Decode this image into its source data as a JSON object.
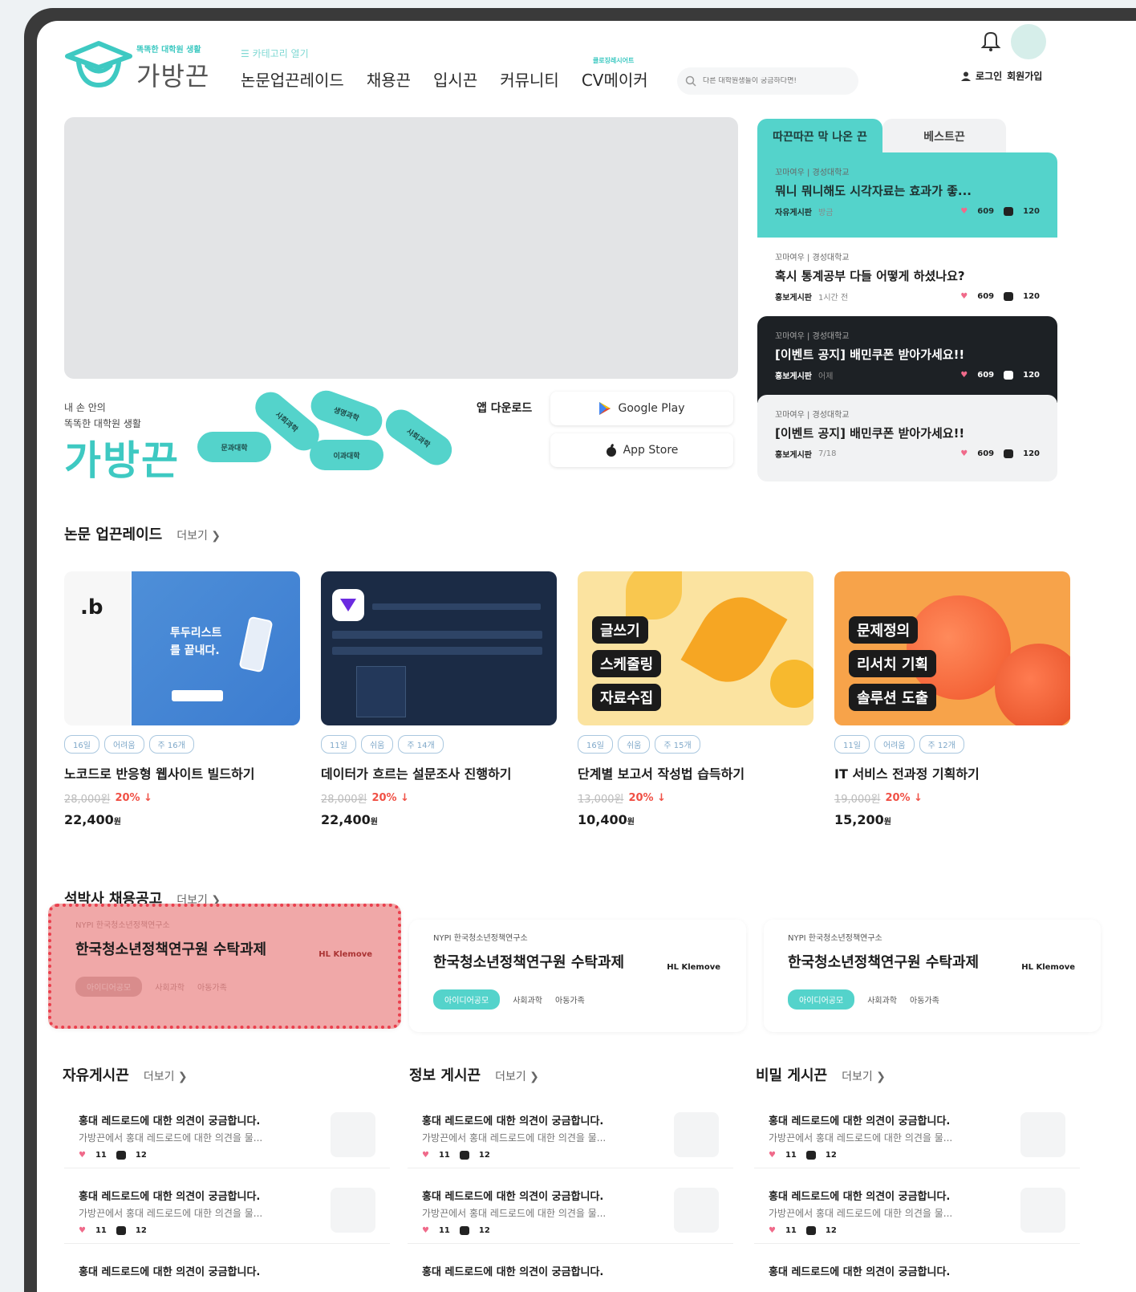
{
  "brand": {
    "slogan": "똑똑한 대학원 생활",
    "name": "가방끈",
    "nav_hint": "☰ 카테고리 열기"
  },
  "nav": {
    "items": [
      "논문업끈레이드",
      "채용끈",
      "입시끈",
      "커뮤니티",
      "CV메이커"
    ],
    "cv_badge": "클로징레시어트"
  },
  "search": {
    "placeholder": "다른 대학원생들이 궁금하다면!"
  },
  "auth": {
    "login": "로그인",
    "signup": "회원가입"
  },
  "promo": {
    "tagline_1": "내 손 안의",
    "tagline_2": "똑똑한 대학원 생활",
    "brand_big": "가방끈",
    "pills": [
      "문과대학",
      "사회과학",
      "생명과학",
      "이과대학",
      "사회과학"
    ],
    "app_title": "앱 다운로드",
    "google_play": "Google Play",
    "app_store": "App Store"
  },
  "side": {
    "tab_active": "따끈따끈 막 나온 끈",
    "tab_inactive": "베스트끈",
    "posts": [
      {
        "meta": "꼬마여우 | 경성대학교",
        "title": "뭐니 뭐니해도 시각자료는 효과가 좋...",
        "board": "자유게시판",
        "time": "방금",
        "likes": "609",
        "comments": "120"
      },
      {
        "meta": "꼬마여우 | 경성대학교",
        "title": "혹시 통계공부 다들 어떻게 하셨나요?",
        "board": "홍보게시판",
        "time": "1시간 전",
        "likes": "609",
        "comments": "120"
      },
      {
        "meta": "꼬마여우 | 경성대학교",
        "title": "[이벤트 공지] 배민쿠폰 받아가세요!!",
        "board": "홍보게시판",
        "time": "어제",
        "likes": "609",
        "comments": "120"
      },
      {
        "meta": "꼬마여우 | 경성대학교",
        "title": "[이벤트 공지] 배민쿠폰 받아가세요!!",
        "board": "홍보게시판",
        "time": "7/18",
        "likes": "609",
        "comments": "120"
      }
    ]
  },
  "upgrade": {
    "title": "논문 업끈레이드",
    "more": "더보기",
    "courses": [
      {
        "tags": [
          "16일",
          "어려움",
          "주 16개"
        ],
        "title": "노코드로 반응형 웹사이트 빌드하기",
        "orig": "28,000원",
        "disc": "20% ↓",
        "price": "22,400",
        "unit": "원"
      },
      {
        "tags": [
          "11일",
          "쉬움",
          "주 14개"
        ],
        "title": "데이터가 흐르는 설문조사 진행하기",
        "orig": "28,000원",
        "disc": "20% ↓",
        "price": "22,400",
        "unit": "원"
      },
      {
        "tags": [
          "16일",
          "쉬움",
          "주 15개"
        ],
        "title": "단계별 보고서 작성법 습득하기",
        "orig": "13,000원",
        "disc": "20% ↓",
        "price": "10,400",
        "unit": "원"
      },
      {
        "tags": [
          "11일",
          "어려움",
          "주 12개"
        ],
        "title": "IT 서비스 전과정 기획하기",
        "orig": "19,000원",
        "disc": "20% ↓",
        "price": "15,200",
        "unit": "원"
      }
    ],
    "thumb_labels": {
      "c1": [
        "투두리스트",
        "를 끝내다."
      ],
      "c3": [
        "글쓰기",
        "스케줄링",
        "자료수집"
      ],
      "c4": [
        "문제정의",
        "리서치 기획",
        "솔루션 도출"
      ]
    }
  },
  "jobs": {
    "title": "석박사 채용공고",
    "more": "더보기",
    "items": [
      {
        "org": "NYPI 한국청소년정책연구소",
        "title": "한국청소년정책연구원 수탁과제",
        "logo": "HL Klemove",
        "chip": "아이디어공모",
        "field": "사회과학",
        "sub": "아동가족"
      },
      {
        "org": "NYPI 한국청소년정책연구소",
        "title": "한국청소년정책연구원 수탁과제",
        "logo": "HL Klemove",
        "chip": "아이디어공모",
        "field": "사회과학",
        "sub": "아동가족"
      },
      {
        "org": "NYPI 한국청소년정책연구소",
        "title": "한국청소년정책연구원 수탁과제",
        "logo": "HL Klemove",
        "chip": "아이디어공모",
        "field": "사회과학",
        "sub": "아동가족"
      }
    ]
  },
  "boards": [
    {
      "title": "자유게시끈",
      "more": "더보기"
    },
    {
      "title": "정보 게시끈",
      "more": "더보기"
    },
    {
      "title": "비밀 게시끈",
      "more": "더보기"
    }
  ],
  "board_post": {
    "title": "홍대 레드로드에 대한 의견이 궁금합니다.",
    "body": "가방끈에서 홍대 레드로드에 대한 의견을 물...",
    "likes": "11",
    "comments": "12"
  },
  "colors": {
    "accent": "#54d3cb",
    "dark_card": "#1d2125",
    "light_card": "#f1f2f3",
    "discount": "#f05045"
  }
}
